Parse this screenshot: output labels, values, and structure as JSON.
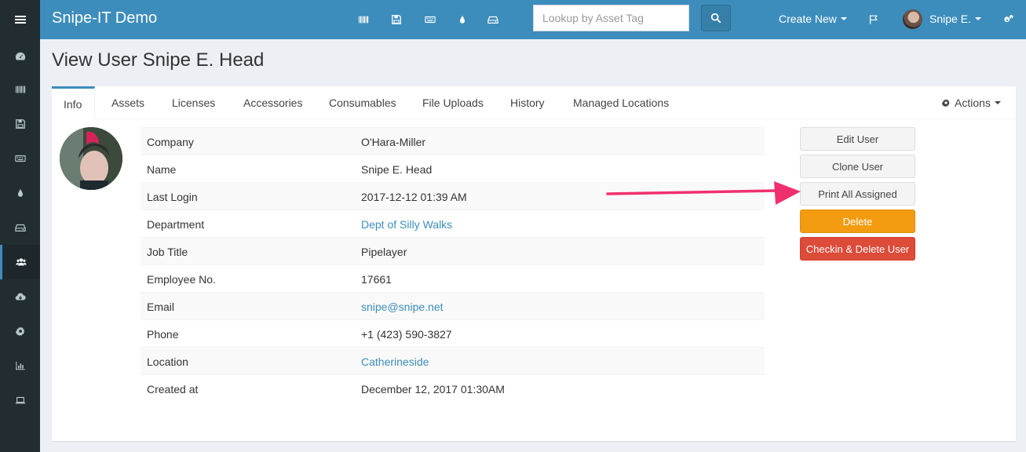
{
  "app": {
    "brand": "Snipe-IT Demo",
    "search_placeholder": "Lookup by Asset Tag",
    "create_new_label": "Create New",
    "user_label": "Snipe E."
  },
  "top_icons": [
    "barcode-icon",
    "save-icon",
    "keyboard-icon",
    "tint-icon",
    "hdd-icon"
  ],
  "sidebar": {
    "items": [
      "dashboard-icon",
      "barcode-icon",
      "save-icon",
      "keyboard-icon",
      "tint-icon",
      "hdd-icon",
      "users-icon",
      "cloud-download-icon",
      "cog-icon",
      "chart-icon",
      "laptop-icon"
    ],
    "active": "users-icon"
  },
  "page": {
    "title": "View User Snipe E. Head"
  },
  "tabs": [
    "Info",
    "Assets",
    "Licenses",
    "Accessories",
    "Consumables",
    "File Uploads",
    "History",
    "Managed Locations"
  ],
  "actions_label": "Actions",
  "details": [
    {
      "label": "Company",
      "value": "O'Hara-Miller"
    },
    {
      "label": "Name",
      "value": "Snipe E. Head"
    },
    {
      "label": "Last Login",
      "value": "2017-12-12 01:39 AM"
    },
    {
      "label": "Department",
      "value": "Dept of Silly Walks"
    },
    {
      "label": "Job Title",
      "value": "Pipelayer"
    },
    {
      "label": "Employee No.",
      "value": "17661"
    },
    {
      "label": "Email",
      "value": "snipe@snipe.net"
    },
    {
      "label": "Phone",
      "value": "+1 (423) 590-3827"
    },
    {
      "label": "Location",
      "value": "Catherineside"
    },
    {
      "label": "Created at",
      "value": "December 12, 2017 01:30AM"
    }
  ],
  "buttons": {
    "edit": "Edit User",
    "clone": "Clone User",
    "print": "Print All Assigned",
    "delete": "Delete",
    "checkin_delete": "Checkin & Delete User"
  },
  "colors": {
    "primary": "#3c8dbc",
    "sidebar": "#222d32",
    "warning": "#f39c12",
    "danger": "#dd4b39",
    "arrow": "#f0306e"
  }
}
